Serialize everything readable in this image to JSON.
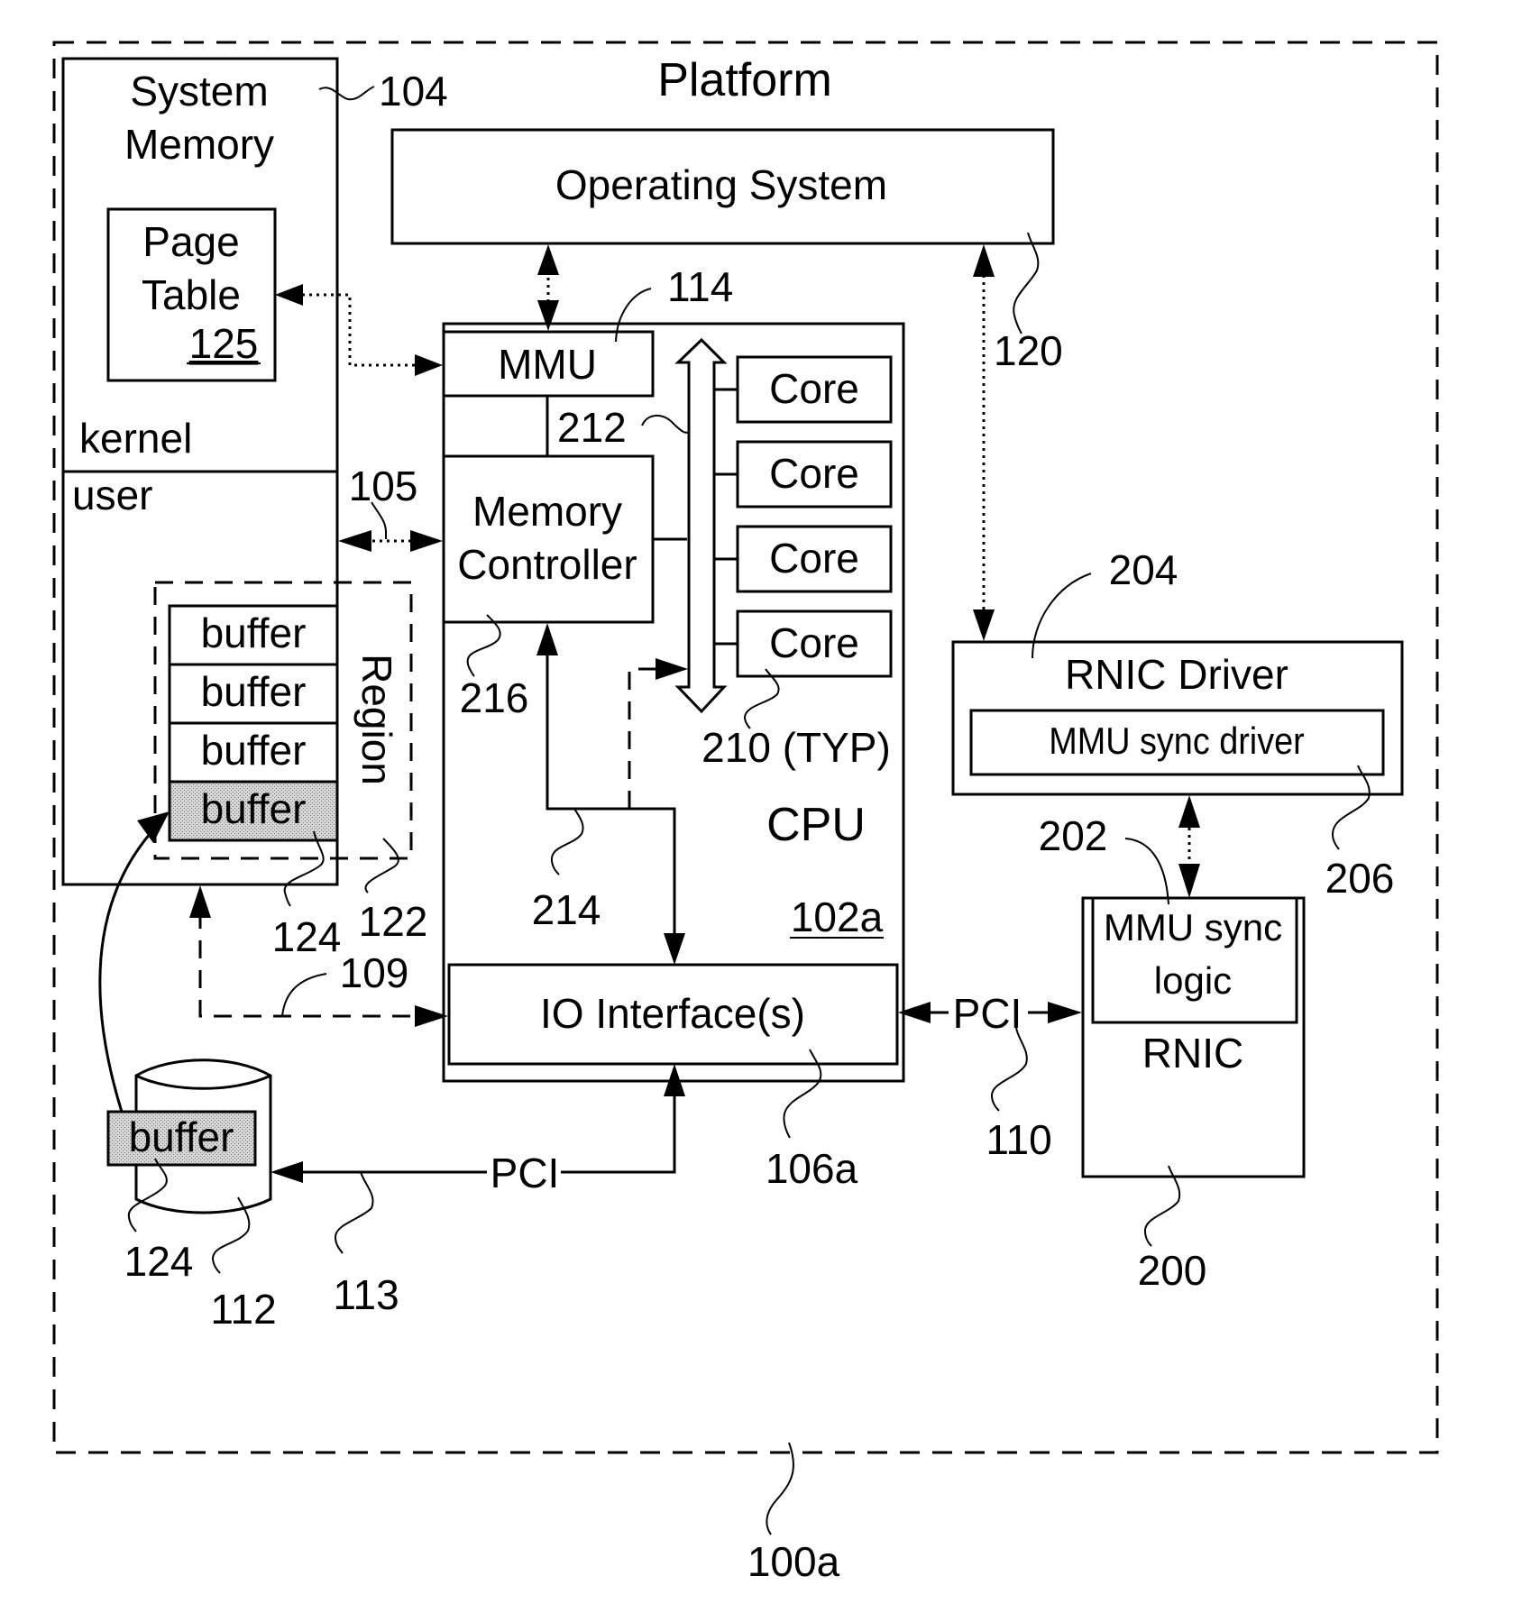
{
  "figure": {
    "platform": {
      "title": "Platform",
      "ref": "100a"
    },
    "system_memory": {
      "title_line1": "System",
      "title_line2": "Memory",
      "ref": "104",
      "kernel_label": "kernel",
      "user_label": "user",
      "page_table": {
        "line1": "Page",
        "line2": "Table",
        "ref": "125"
      },
      "region": {
        "label": "Region",
        "ref": "122"
      },
      "buffers": [
        "buffer",
        "buffer",
        "buffer",
        "buffer"
      ],
      "buffer_ref": "124"
    },
    "operating_system": {
      "label": "Operating System",
      "ref": "120"
    },
    "cpu": {
      "label": "CPU",
      "ref": "102a",
      "mmu": {
        "label": "MMU",
        "ref": "114"
      },
      "memory_controller": {
        "line1": "Memory",
        "line2": "Controller",
        "ref": "216"
      },
      "cores": [
        "Core",
        "Core",
        "Core",
        "Core"
      ],
      "core_ref": "210 (TYP)",
      "interconnect_ref": "212",
      "io_path_ref": "214",
      "io_interface": {
        "label": "IO Interface(s)",
        "ref": "106a"
      }
    },
    "links": {
      "memory_bus_ref": "105",
      "dma_path_ref": "109",
      "rnic_pci": {
        "label": "PCI",
        "ref": "110"
      },
      "storage_pci": {
        "label": "PCI",
        "ref": "113"
      },
      "driver_link_ref": "202"
    },
    "storage": {
      "ref": "112",
      "buffer_label": "buffer",
      "buffer_ref": "124"
    },
    "rnic_driver": {
      "label": "RNIC Driver",
      "ref": "204",
      "mmu_sync_driver": {
        "label": "MMU sync driver",
        "ref": "206"
      }
    },
    "rnic": {
      "label": "RNIC",
      "ref": "200",
      "mmu_sync_logic": {
        "line1": "MMU sync",
        "line2": "logic",
        "ref": "202"
      }
    }
  }
}
